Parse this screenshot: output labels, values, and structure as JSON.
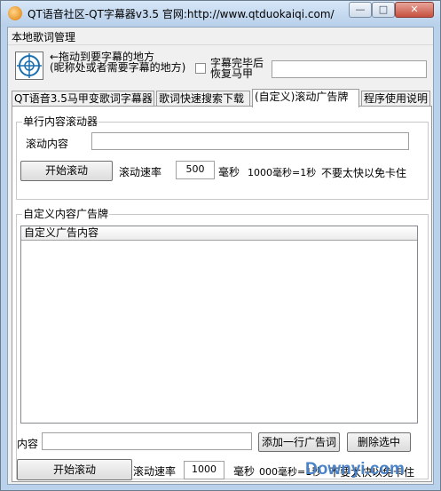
{
  "window": {
    "title": "QT语音社区-QT字幕器v3.5 官网:http://www.qtduokaiqi.com/",
    "minimize": "—",
    "maximize": "□",
    "close": "✕"
  },
  "menubar": {
    "item": "本地歌词管理"
  },
  "picker": {
    "line1": "←拖动到要字幕的地方",
    "line2": "(昵称处或者需要字幕的地方)",
    "checkbox_line1": "字幕完毕后",
    "checkbox_line2": "恢复马甲",
    "input_value": ""
  },
  "tabs": [
    {
      "label": "QT语音3.5马甲变歌词字幕器"
    },
    {
      "label": "歌词快速搜索下载"
    },
    {
      "label": "(自定义)滚动广告牌"
    },
    {
      "label": "程序使用说明"
    }
  ],
  "single": {
    "group_title": "单行内容滚动器",
    "content_label": "滚动内容",
    "content_value": "",
    "start_button": "开始滚动",
    "speed_label": "滚动速率",
    "speed_value": "500",
    "unit": "毫秒",
    "note": "1000毫秒=1秒",
    "tip": "不要太快以免卡住"
  },
  "custom": {
    "group_title": "自定义内容广告牌",
    "list_header": "自定义广告内容",
    "content_label": "内容",
    "content_value": "",
    "add_button": "添加一行广告词",
    "delete_button": "删除选中",
    "start_button": "开始滚动",
    "speed_label": "滚动速率",
    "speed_value": "1000",
    "unit": "毫秒",
    "note": "000毫秒=1秒",
    "tip": "不要太快以免卡住"
  },
  "watermark": "Downyi.com"
}
